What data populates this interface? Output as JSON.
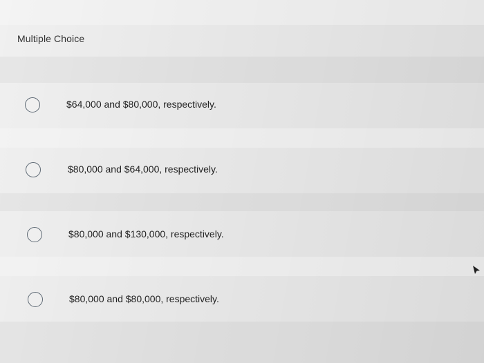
{
  "question": {
    "type_label": "Multiple Choice"
  },
  "options": [
    {
      "label": "$64,000 and $80,000, respectively."
    },
    {
      "label": "$80,000 and $64,000, respectively."
    },
    {
      "label": "$80,000 and $130,000, respectively."
    },
    {
      "label": "$80,000 and $80,000, respectively."
    }
  ],
  "icons": {
    "radio": "radio-button-unselected-icon",
    "cursor": "mouse-pointer-icon"
  },
  "colors": {
    "background": "#e8e8e8",
    "radio_border": "#5f6a75",
    "text": "#222222"
  }
}
